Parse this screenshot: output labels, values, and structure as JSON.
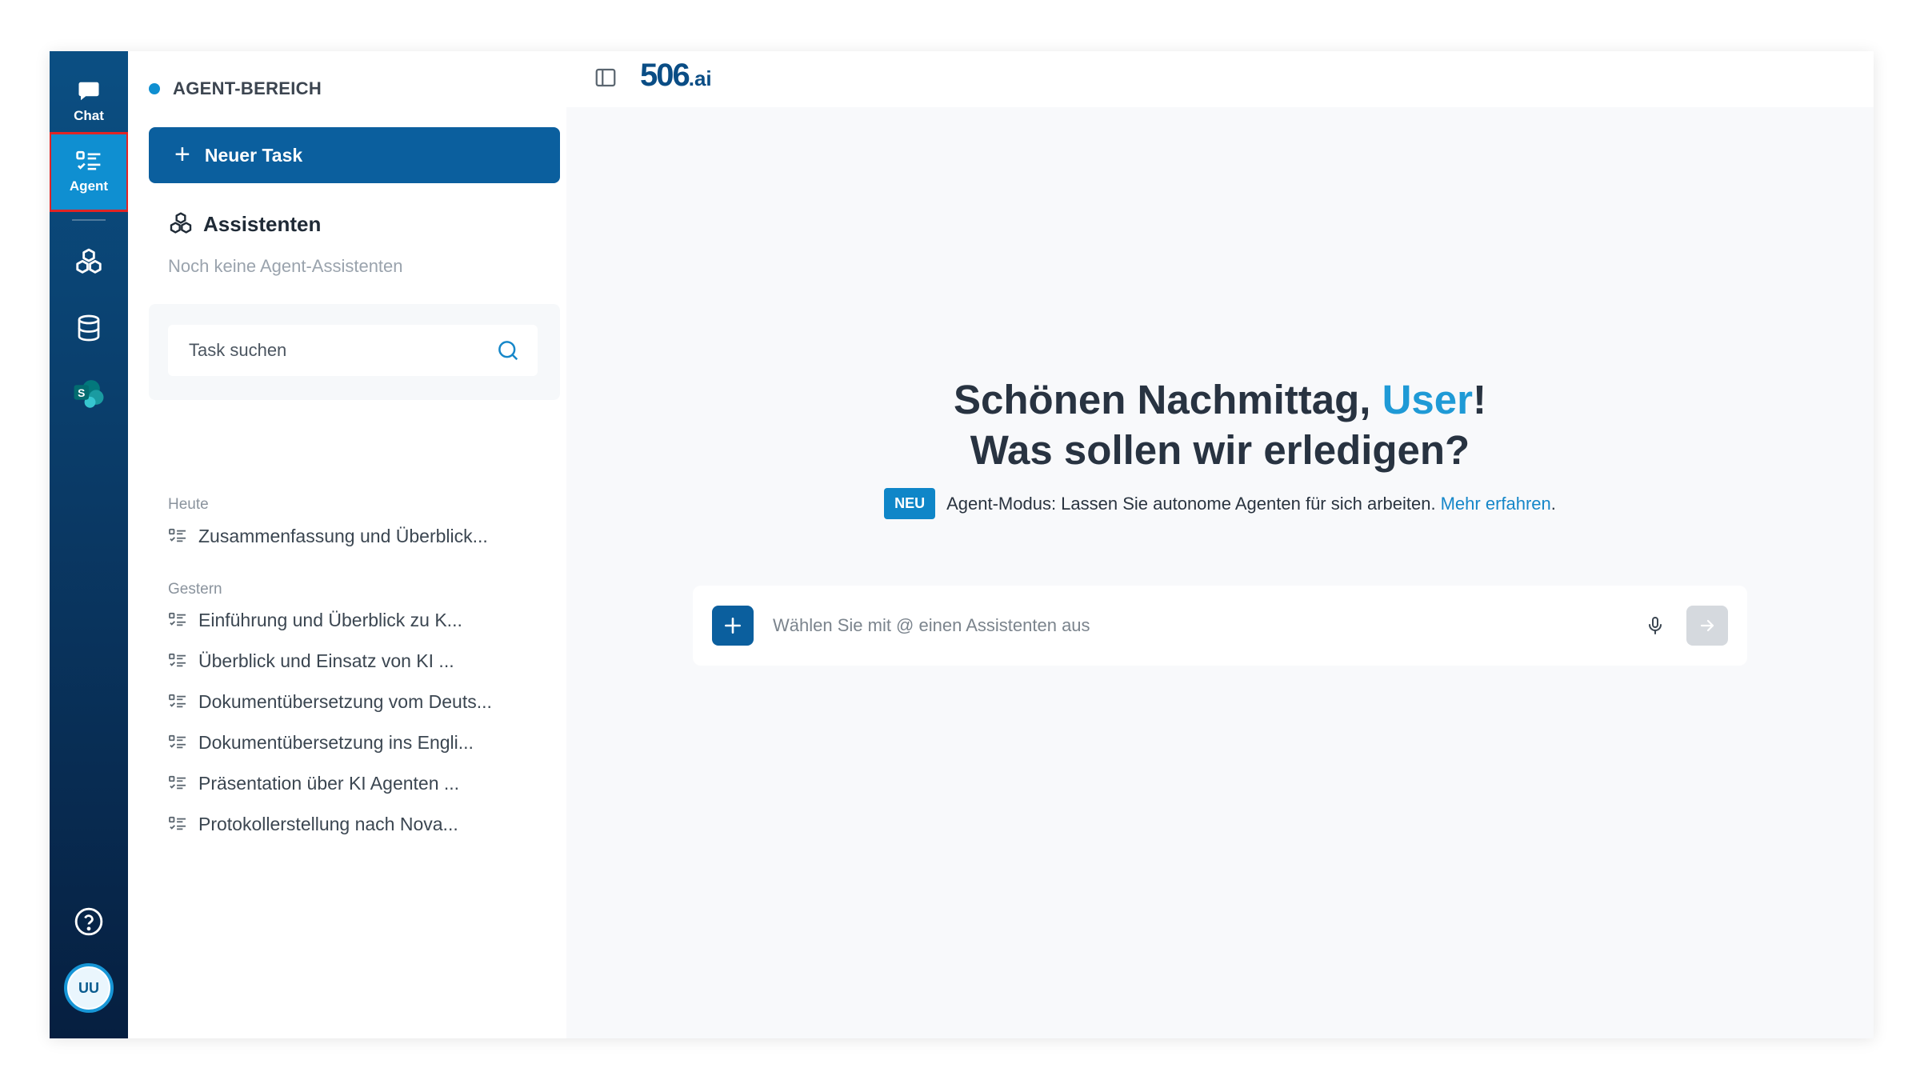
{
  "rail": {
    "chat_label": "Chat",
    "agent_label": "Agent",
    "avatar_initials": "UU"
  },
  "panel": {
    "section_title": "AGENT-BEREICH",
    "new_task_label": "Neuer Task",
    "assistants_title": "Assistenten",
    "assistants_empty": "Noch keine Agent-Assistenten",
    "search_placeholder": "Task suchen",
    "groups": [
      {
        "label": "Heute",
        "tasks": [
          "Zusammenfassung und Überblick..."
        ]
      },
      {
        "label": "Gestern",
        "tasks": [
          "Einführung und Überblick zu K...",
          "Überblick und Einsatz von KI ...",
          "Dokumentübersetzung vom Deuts...",
          "Dokumentübersetzung ins Engli...",
          "Präsentation über KI Agenten ...",
          "Protokollerstellung nach Nova..."
        ]
      }
    ]
  },
  "main": {
    "logo_main": "506",
    "logo_suffix": ".ai",
    "greeting_prefix": "Schönen Nachmittag, ",
    "greeting_user": "User",
    "greeting_suffix": "!",
    "greeting_line2": "Was sollen wir erledigen?",
    "badge": "NEU",
    "notice_text": "Agent-Modus: Lassen Sie autonome Agenten für sich arbeiten.",
    "notice_link": "Mehr erfahren",
    "notice_end": ".",
    "composer_placeholder": "Wählen Sie mit @ einen Assistenten aus"
  },
  "colors": {
    "primary": "#0b5f9e",
    "accent": "#0f8fd1",
    "highlight_border": "#e02424"
  }
}
